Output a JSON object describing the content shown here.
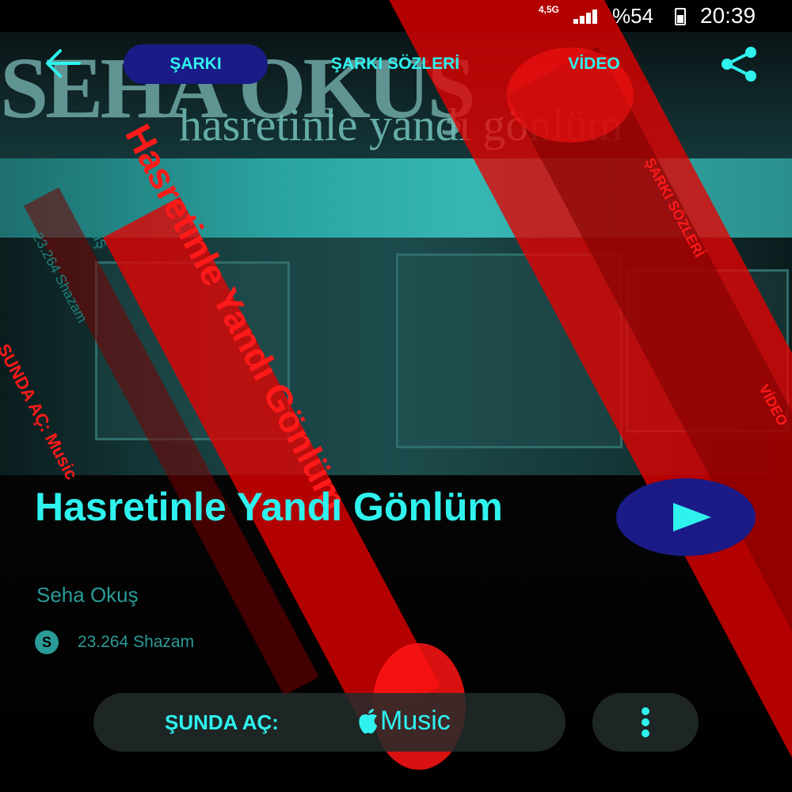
{
  "status_bar": {
    "network": "4,5G",
    "battery": "%54",
    "time": "20:39"
  },
  "artwork": {
    "cover_artist": "SEHA OKUŞ",
    "cover_title": "hasretinle yandı gönlüm",
    "ghost_title": "Hasretinle Yandı Gönlüm",
    "ghost_artist": "Seha Okuş",
    "ghost_count": "23.264 Shazam",
    "ghost_open": "ŞUNDA AÇ: Music",
    "ghost_tabs": "ŞARKI SÖZLERİ",
    "ghost_video": "VİDEO"
  },
  "nav": {
    "tabs": [
      {
        "label": "ŞARKI",
        "active": true
      },
      {
        "label": "ŞARKI SÖZLERİ",
        "active": false
      },
      {
        "label": "VİDEO",
        "active": false
      }
    ]
  },
  "song": {
    "title": "Hasretinle Yandı Gönlüm",
    "artist": "Seha Okuş",
    "shazam_count": "23.264 Shazam"
  },
  "actions": {
    "open_in_label": "ŞUNDA AÇ:",
    "music_service": "Music"
  },
  "colors": {
    "accent": "#2ff2ee",
    "muted_accent": "#2a9b98",
    "active_tab_bg": "#1a1b86",
    "overlay_red": "#e60000"
  }
}
